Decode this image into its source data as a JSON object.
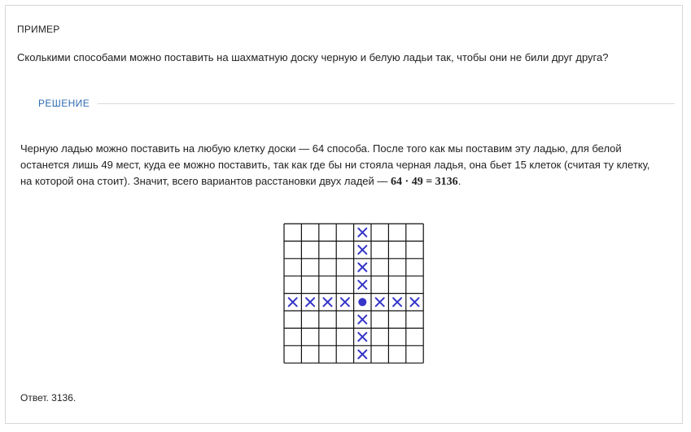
{
  "example": {
    "title": "ПРИМЕР",
    "question": "Сколькими способами можно поставить на шахматную доску черную и белую ладьи так, чтобы они не били друг друга?"
  },
  "solution": {
    "label": "РЕШЕНИЕ",
    "line1": "Черную ладью можно поставить на любую клетку доски — 64 способа. После того как мы поставим эту ладью, для белой",
    "line2": "останется лишь 49 мест, куда ее можно поставить, так как где бы ни стояла черная ладья, она бьет 15 клеток (считая ту клетку,",
    "line3_text": "на которой она стоит). Значит, всего вариантов расстановки двух ладей — ",
    "line3_math": "64 · 49 = 3136",
    "line3_end": "."
  },
  "board": {
    "size": 8,
    "rook": {
      "row": 5,
      "col": 5
    },
    "mark_color": "#3535c8",
    "line_color": "#111111"
  },
  "answer": "Ответ. 3136."
}
